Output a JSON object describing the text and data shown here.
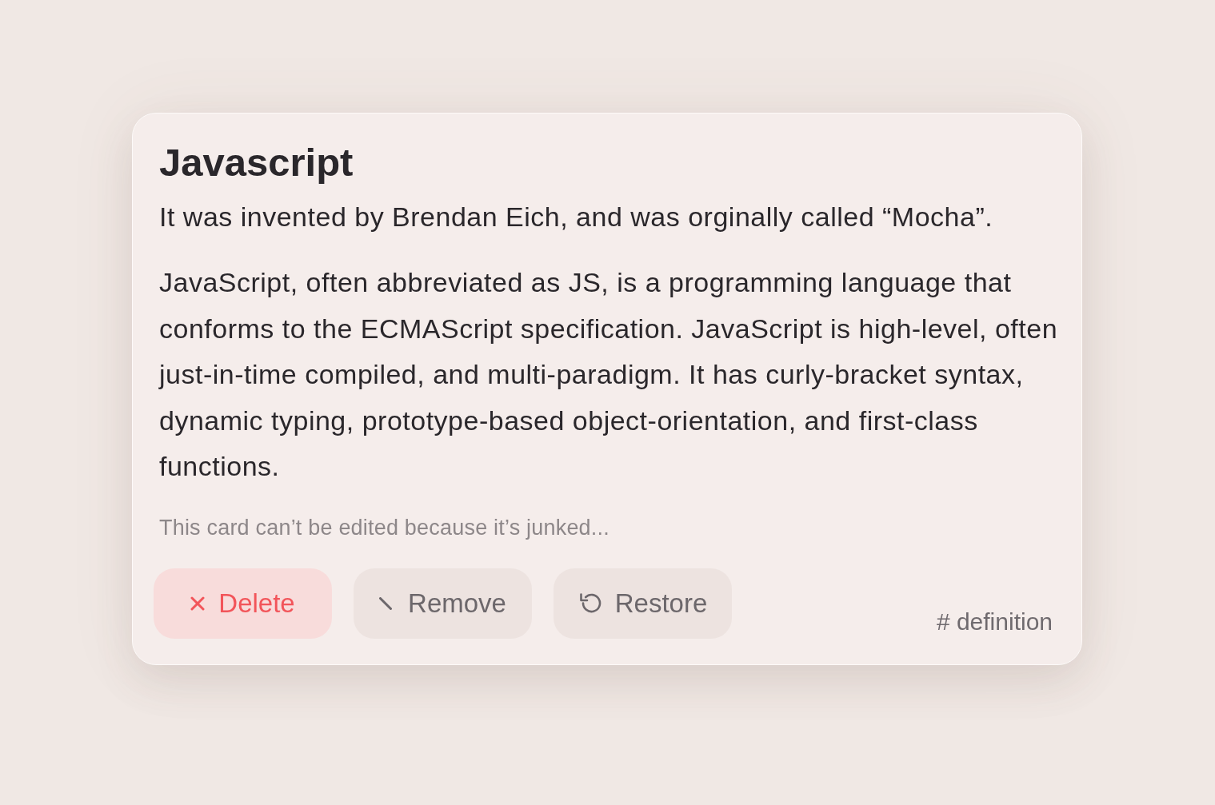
{
  "card": {
    "title": "Javascript",
    "subtitle": "It was invented by Brendan Eich, and was orginally called “Mocha”.",
    "description": "JavaScript, often abbreviated as JS, is a programming language that conforms to the ECMAScript specification. JavaScript is high-level, often just-in-time compiled, and multi-paradigm. It has curly-bracket syntax, dynamic typing, prototype-based object-orientation, and first-class functions.",
    "notice": "This card can’t be edited because it’s junked...",
    "actions": [
      {
        "kind": "delete",
        "label": "Delete"
      },
      {
        "kind": "remove",
        "label": "Remove"
      },
      {
        "kind": "restore",
        "label": "Restore"
      }
    ],
    "tag": "# definition"
  }
}
